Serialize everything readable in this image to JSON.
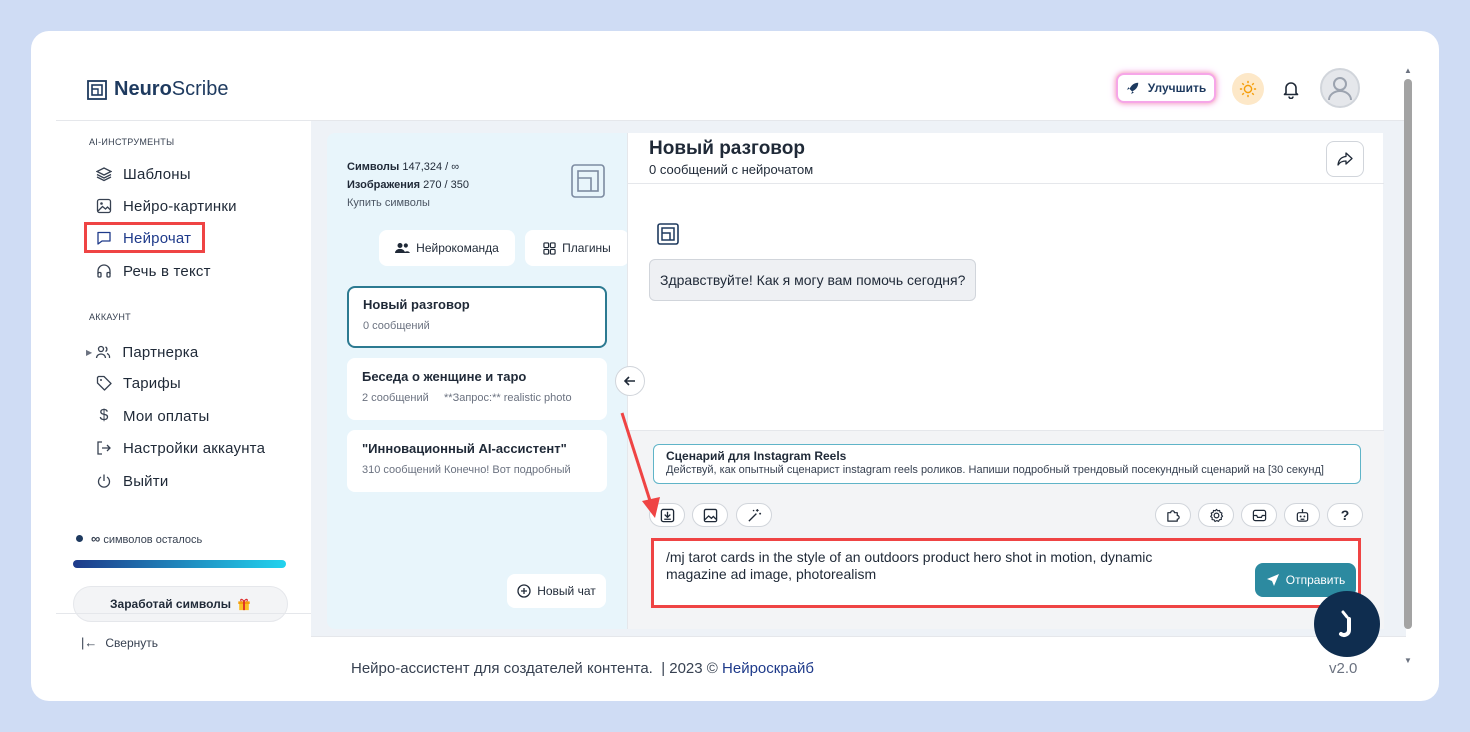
{
  "header": {
    "logo_bold": "Neuro",
    "logo_regular": "Scribe",
    "upgrade_label": "Улучшить"
  },
  "sidebar": {
    "section_tools": "AI-ИНСТРУМЕНТЫ",
    "tools": [
      {
        "label": "Шаблоны",
        "icon": "layers-icon"
      },
      {
        "label": "Нейро-картинки",
        "icon": "image-icon"
      },
      {
        "label": "Нейрочат",
        "icon": "chat-bubble-icon"
      },
      {
        "label": "Речь в текст",
        "icon": "headphones-icon"
      }
    ],
    "section_account": "АККАУНТ",
    "account": [
      {
        "label": "Партнерка",
        "icon": "users-icon"
      },
      {
        "label": "Тарифы",
        "icon": "tag-icon"
      },
      {
        "label": "Мои оплаты",
        "icon": "dollar-icon"
      },
      {
        "label": "Настройки аккаунта",
        "icon": "login-icon"
      },
      {
        "label": "Выйти",
        "icon": "power-icon"
      }
    ],
    "quota_symbol": "∞",
    "quota_text": "символов осталось",
    "earn_label": "Заработай символы",
    "collapse_label": "Свернуть"
  },
  "chat_list": {
    "symbols_label": "Символы",
    "symbols_value": "147,324 / ∞",
    "images_label": "Изображения",
    "images_value": "270 / 350",
    "buy_label": "Купить символы",
    "team_button": "Нейрокоманда",
    "plugins_button": "Плагины",
    "chats": [
      {
        "title": "Новый разговор",
        "subtitle": "0 сообщений"
      },
      {
        "title": "Беседа о женщине и таро",
        "subtitle": "2 сообщений     **Запрос:** realistic photo"
      },
      {
        "title": "\"Инновационный AI-ассистент\"",
        "subtitle": "310 сообщений  Конечно! Вот подробный"
      }
    ],
    "new_chat_button": "Новый чат"
  },
  "chat": {
    "title": "Новый разговор",
    "subtitle": "0 сообщений с нейрочатом",
    "bot_message": "Здравствуйте! Как я могу вам помочь сегодня?",
    "template_title": "Сценарий для Instagram Reels",
    "template_desc": "Действуй, как опытный сценарист instagram reels роликов. Напиши подробный трендовый посекундный сценарий на [30 секунд]",
    "input_value": "/mj tarot cards in the style of an outdoors product hero shot in motion, dynamic magazine ad image, photorealism",
    "send_label": "Отправить",
    "help_label": "?"
  },
  "footer": {
    "text": "Нейро-ассистент для создателей контента.  | 2023 © ",
    "link": "Нейроскрайб",
    "version": "v2.0"
  },
  "colors": {
    "accent": "#2c8aa0",
    "highlight": "#ef4444",
    "brand": "#1e3a5f"
  }
}
